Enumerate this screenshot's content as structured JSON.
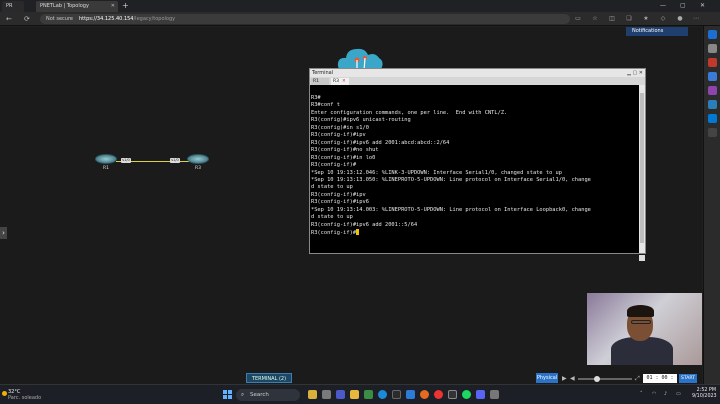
{
  "browser": {
    "tabs": [
      {
        "label": "PR"
      },
      {
        "label": "PNETLab | Topology"
      }
    ],
    "url": {
      "security": "Not secure",
      "host": "https://34.125.40.154",
      "path": "/legacy/topology"
    }
  },
  "notifications": {
    "label": "Notifications"
  },
  "topology": {
    "routers": [
      {
        "name": "R1",
        "interface": "s1/0"
      },
      {
        "name": "R3",
        "interface": "s1/0"
      }
    ],
    "link_color": "#d9d14a"
  },
  "terminal": {
    "title": "Terminal",
    "tabs": [
      {
        "label": "R1"
      },
      {
        "label": "R3"
      }
    ],
    "lines": [
      "R3#",
      "R3#conf t",
      "Enter configuration commands, one per line.  End with CNTL/Z.",
      "R3(config)#ipv6 unicast-routing",
      "R3(config)#in s1/0",
      "R3(config-if)#ipv",
      "R3(config-if)#ipv6 add 2001:abcd:abcd::2/64",
      "R3(config-if)#no shut",
      "R3(config-if)#in lo0",
      "R3(config-if)#",
      "*Sep 10 19:13:12.046: %LINK-3-UPDOWN: Interface Serial1/0, changed state to up",
      "*Sep 10 19:13:13.050: %LINEPROTO-5-UPDOWN: Line protocol on Interface Serial1/0, change",
      "d state to up",
      "R3(config-if)#ipv",
      "R3(config-if)#ipv6",
      "*Sep 10 19:13:14.003: %LINEPROTO-5-UPDOWN: Line protocol on Interface Loopback0, change",
      "d state to up",
      "R3(config-if)#ipv6 add 2001::5/64"
    ],
    "prompt": "R3(config-if)#"
  },
  "bottom": {
    "terminal_button": "TERMINAL (2)",
    "physical": "Physical",
    "timer": "01 : 00 : 00",
    "start": "START"
  },
  "taskbar": {
    "weather_temp": "32°C",
    "weather_desc": "Parc. soleado",
    "search": "Search",
    "time": "2:52 PM",
    "date": "9/10/2023"
  }
}
